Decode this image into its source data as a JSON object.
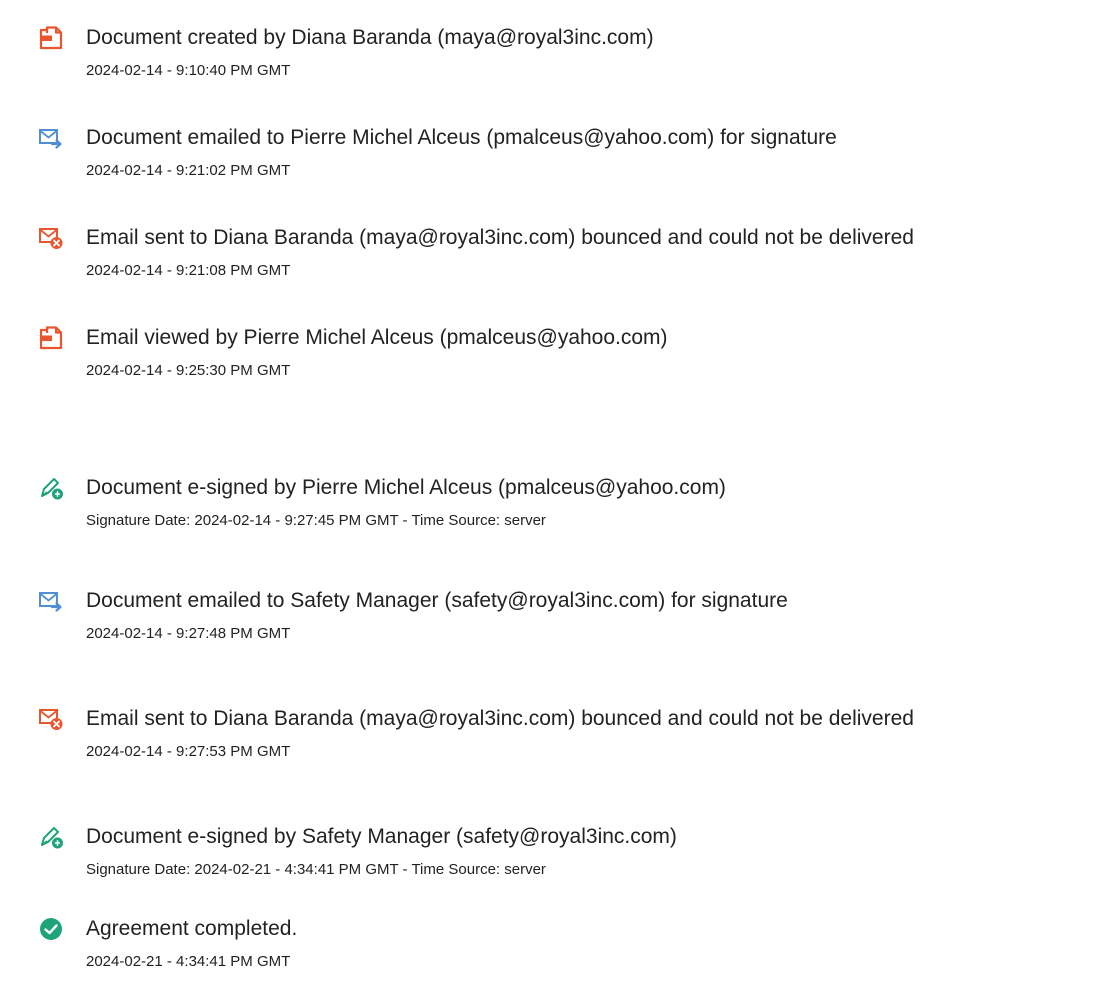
{
  "colors": {
    "document_icon": "#e8552e",
    "mail_icon": "#4f8fd3",
    "bounce_badge": "#e8552e",
    "esign_badge": "#1fa37a",
    "complete_badge": "#1fa37a",
    "text": "#222222"
  },
  "events": [
    {
      "icon": "document-icon",
      "title": "Document created by Diana Baranda (maya@royal3inc.com)",
      "detail": "2024-02-14 - 9:10:40 PM GMT"
    },
    {
      "icon": "email-sent-icon",
      "title": "Document emailed to Pierre Michel Alceus (pmalceus@yahoo.com) for signature",
      "detail": "2024-02-14 - 9:21:02 PM GMT"
    },
    {
      "icon": "email-bounced-icon",
      "title": "Email sent to Diana Baranda (maya@royal3inc.com) bounced and could not be delivered",
      "detail": "2024-02-14 - 9:21:08 PM GMT"
    },
    {
      "icon": "document-icon",
      "title": "Email viewed by Pierre Michel Alceus (pmalceus@yahoo.com)",
      "detail": "2024-02-14 - 9:25:30 PM GMT"
    },
    {
      "icon": "esign-pen-icon",
      "title": "Document e-signed by Pierre Michel Alceus (pmalceus@yahoo.com)",
      "detail": "Signature Date: 2024-02-14 - 9:27:45 PM GMT - Time Source: server"
    },
    {
      "icon": "email-sent-icon",
      "title": "Document emailed to Safety Manager (safety@royal3inc.com) for signature",
      "detail": "2024-02-14 - 9:27:48 PM GMT"
    },
    {
      "icon": "email-bounced-icon",
      "title": "Email sent to Diana Baranda (maya@royal3inc.com) bounced and could not be delivered",
      "detail": "2024-02-14 - 9:27:53 PM GMT"
    },
    {
      "icon": "esign-pen-icon",
      "title": "Document e-signed by Safety Manager (safety@royal3inc.com)",
      "detail": "Signature Date: 2024-02-21 - 4:34:41 PM GMT - Time Source: server"
    },
    {
      "icon": "check-circle-icon",
      "title": "Agreement completed.",
      "detail": "2024-02-21 - 4:34:41 PM GMT"
    }
  ]
}
